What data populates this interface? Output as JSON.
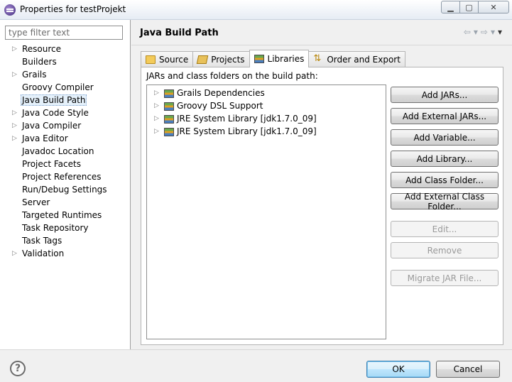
{
  "window": {
    "title": "Properties for testProjekt"
  },
  "filter": {
    "placeholder": "type filter text"
  },
  "tree": [
    {
      "label": "Resource",
      "expandable": true
    },
    {
      "label": "Builders",
      "expandable": false
    },
    {
      "label": "Grails",
      "expandable": true
    },
    {
      "label": "Groovy Compiler",
      "expandable": false
    },
    {
      "label": "Java Build Path",
      "expandable": false,
      "selected": true
    },
    {
      "label": "Java Code Style",
      "expandable": true
    },
    {
      "label": "Java Compiler",
      "expandable": true
    },
    {
      "label": "Java Editor",
      "expandable": true
    },
    {
      "label": "Javadoc Location",
      "expandable": false
    },
    {
      "label": "Project Facets",
      "expandable": false
    },
    {
      "label": "Project References",
      "expandable": false
    },
    {
      "label": "Run/Debug Settings",
      "expandable": false
    },
    {
      "label": "Server",
      "expandable": false
    },
    {
      "label": "Targeted Runtimes",
      "expandable": false
    },
    {
      "label": "Task Repository",
      "expandable": false
    },
    {
      "label": "Task Tags",
      "expandable": false
    },
    {
      "label": "Validation",
      "expandable": true
    }
  ],
  "page": {
    "title": "Java Build Path"
  },
  "tabs": [
    {
      "label": "Source",
      "icon": "source-folder-icon"
    },
    {
      "label": "Projects",
      "icon": "projects-icon"
    },
    {
      "label": "Libraries",
      "icon": "libraries-icon",
      "active": true
    },
    {
      "label": "Order and Export",
      "icon": "order-export-icon"
    }
  ],
  "libraries": {
    "caption": "JARs and class folders on the build path:",
    "items": [
      "Grails Dependencies",
      "Groovy DSL Support",
      "JRE System Library [jdk1.7.0_09]",
      "JRE System Library [jdk1.7.0_09]"
    ]
  },
  "buttons": [
    {
      "label": "Add JARs...",
      "enabled": true
    },
    {
      "label": "Add External JARs...",
      "enabled": true
    },
    {
      "label": "Add Variable...",
      "enabled": true
    },
    {
      "label": "Add Library...",
      "enabled": true
    },
    {
      "label": "Add Class Folder...",
      "enabled": true
    },
    {
      "label": "Add External Class Folder...",
      "enabled": true
    },
    {
      "label": "Edit...",
      "enabled": false
    },
    {
      "label": "Remove",
      "enabled": false
    },
    {
      "label": "Migrate JAR File...",
      "enabled": false
    }
  ],
  "dialog": {
    "ok": "OK",
    "cancel": "Cancel"
  }
}
